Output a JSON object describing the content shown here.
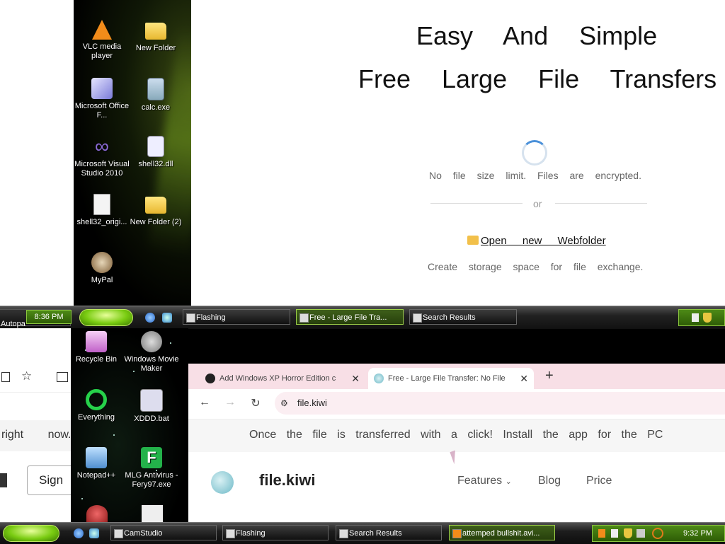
{
  "top_window": {
    "desktop_icons": [
      {
        "label": "VLC media player",
        "icon": "vlc-icon"
      },
      {
        "label": "New Folder",
        "icon": "folder-icon"
      },
      {
        "label": "Microsoft Office F...",
        "icon": "office-icon"
      },
      {
        "label": "calc.exe",
        "icon": "calculator-icon"
      },
      {
        "label": "Microsoft Visual Studio 2010",
        "icon": "visual-studio-icon"
      },
      {
        "label": "shell32.dll",
        "icon": "dll-file-icon"
      },
      {
        "label": "shell32_origi...",
        "icon": "file-icon"
      },
      {
        "label": "New Folder (2)",
        "icon": "folder-icon"
      },
      {
        "label": "MyPal",
        "icon": "mypal-icon"
      }
    ],
    "page": {
      "headline_1": "Easy And Simple",
      "headline_2": "Free Large File Transfers",
      "info": "No file size limit. Files are encrypted.",
      "or": "or",
      "open_link": "Open new Webfolder",
      "subtext": "Create storage space for file exchange."
    }
  },
  "taskbar_top": {
    "left_fragment": "Autopa",
    "clock": "8:36 PM",
    "buttons": [
      "Flashing",
      "Free - Large File Tra...",
      "Search Results"
    ]
  },
  "lower_left_page": {
    "sign_label": "Sign",
    "text_fragment": "right now."
  },
  "desktop2_icons": [
    {
      "label": "Recycle Bin",
      "icon": "recycle-bin-icon"
    },
    {
      "label": "Windows Movie Maker",
      "icon": "movie-maker-icon"
    },
    {
      "label": "Everything",
      "icon": "everything-icon"
    },
    {
      "label": "XDDD.bat",
      "icon": "bat-file-icon"
    },
    {
      "label": "Notepad++",
      "icon": "notepad-icon"
    },
    {
      "label": "MLG Antivirus - Fery97.exe",
      "icon": "antivirus-icon"
    }
  ],
  "browser": {
    "tabs": [
      {
        "title": "Add Windows XP Horror Edition c",
        "icon": "github-icon",
        "active": false
      },
      {
        "title": "Free - Large File Transfer: No File ",
        "icon": "filekiwi-icon",
        "active": true
      }
    ],
    "url": "file.kiwi",
    "marquee": "Once the file is transferred with a click! Install the app for the PC",
    "site": {
      "brand": "file.kiwi",
      "nav": [
        "Features",
        "Blog",
        "Price"
      ]
    }
  },
  "taskbar_bottom": {
    "clock": "9:32 PM",
    "buttons": [
      "CamStudio",
      "Flashing",
      "Search Results",
      "attemped bullshit.avi..."
    ]
  },
  "colors": {
    "accent_green": "#7acc12",
    "tab_strip": "#f8dfe6",
    "spinner_blue": "#4a90d9"
  }
}
